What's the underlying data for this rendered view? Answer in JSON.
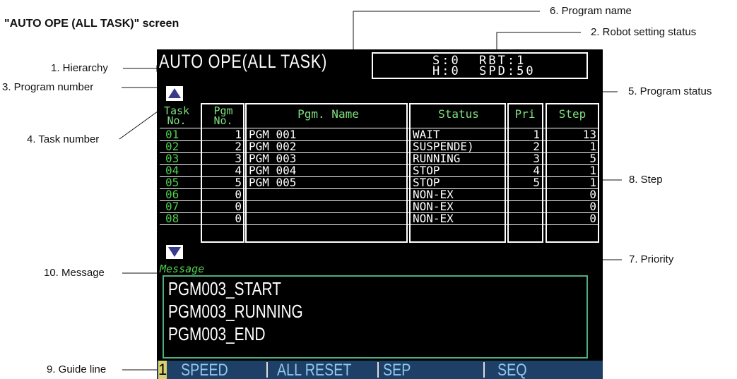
{
  "doc_title": "\"AUTO OPE (ALL TASK)\" screen",
  "annotations": {
    "hierarchy": "1. Hierarchy",
    "robot_setting": "2. Robot setting status",
    "program_number": "3. Program number",
    "task_number": "4. Task number",
    "program_status": "5. Program status",
    "program_name": "6. Program name",
    "priority": "7. Priority",
    "step": "8. Step",
    "guide_line": "9. Guide line",
    "message": "10. Message"
  },
  "screen": {
    "title": "AUTO OPE(ALL TASK)",
    "status_line1": "S:0  RBT:1",
    "status_line2": "H:0  SPD:50",
    "headers": {
      "task_top": "Task",
      "task_bottom": "No.",
      "pgm_top": "Pgm",
      "pgm_bottom": "No.",
      "name": "Pgm. Name",
      "status": "Status",
      "pri": "Pri",
      "step": "Step"
    },
    "rows": [
      {
        "task": "01",
        "pgm": "1",
        "name": "PGM_001",
        "status": "WAIT",
        "pri": "1",
        "step": "13"
      },
      {
        "task": "02",
        "pgm": "2",
        "name": "PGM_002",
        "status": "SUSPENDE)",
        "pri": "2",
        "step": "1"
      },
      {
        "task": "03",
        "pgm": "3",
        "name": "PGM_003",
        "status": "RUNNING",
        "pri": "3",
        "step": "5"
      },
      {
        "task": "04",
        "pgm": "4",
        "name": "PGM_004",
        "status": "STOP",
        "pri": "4",
        "step": "1"
      },
      {
        "task": "05",
        "pgm": "5",
        "name": "PGM_005",
        "status": "STOP",
        "pri": "5",
        "step": "1"
      },
      {
        "task": "06",
        "pgm": "0",
        "name": "",
        "status": "NON-EX",
        "pri": "",
        "step": "0"
      },
      {
        "task": "07",
        "pgm": "0",
        "name": "",
        "status": "NON-EX",
        "pri": "",
        "step": "0"
      },
      {
        "task": "08",
        "pgm": "0",
        "name": "",
        "status": "NON-EX",
        "pri": "",
        "step": "0"
      }
    ],
    "message_label": "Message",
    "messages": [
      "PGM003_START",
      "PGM003_RUNNING",
      "PGM003_END"
    ],
    "guide": {
      "page": "1",
      "keys": [
        "SPEED",
        "ALL RESET",
        "SEP",
        "SEQ"
      ]
    }
  }
}
